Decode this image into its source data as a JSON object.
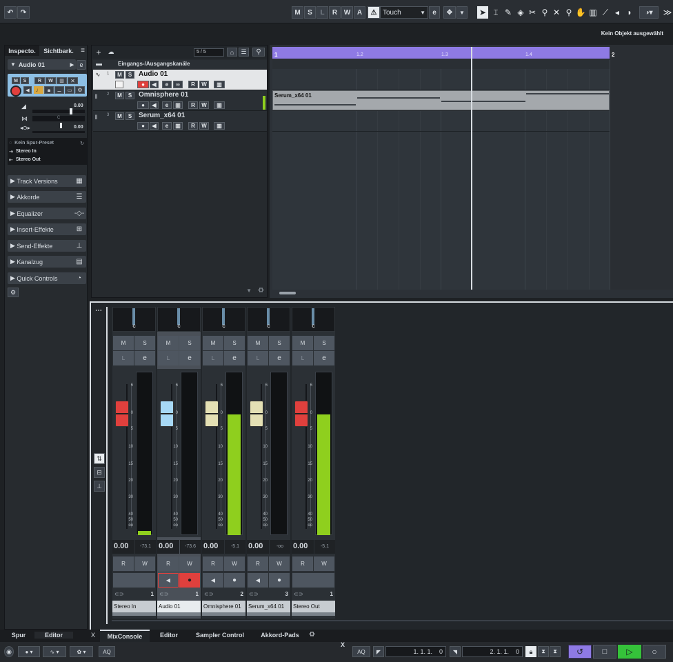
{
  "toolbar": {
    "undo": "↶",
    "redo": "↷",
    "mode_buttons": [
      "M",
      "S",
      "L",
      "R",
      "W",
      "A"
    ],
    "automation_mode": "Touch",
    "tools": [
      "pointer-icon",
      "range-icon",
      "pencil-icon",
      "eraser-icon",
      "scissors-icon",
      "glue-icon",
      "mute-icon",
      "zoom-icon",
      "hand-icon",
      "comp-icon",
      "line-icon",
      "play-icon",
      "color-icon"
    ]
  },
  "status": {
    "selection": "Kein Objekt ausgewählt"
  },
  "inspector": {
    "tabs": [
      "Inspecto.",
      "Sichtbark."
    ],
    "track_name": "Audio 01",
    "vol_value": "0.00",
    "pan_value": "0.00",
    "pan_letter": "C",
    "routing": [
      "Kein Spur-Preset",
      "Stereo In",
      "Stereo Out"
    ],
    "sections": [
      "Track Versions",
      "Akkorde",
      "Equalizer",
      "Insert-Effekte",
      "Send-Effekte",
      "Kanalzug",
      "Quick Controls"
    ]
  },
  "project": {
    "counter": "5 / 5",
    "folder_name": "Eingangs-/Ausgangskanäle",
    "tracks": [
      {
        "num": "1",
        "name": "Audio 01"
      },
      {
        "num": "2",
        "name": "Omnisphere 01"
      },
      {
        "num": "3",
        "name": "Serum_x64 01"
      }
    ],
    "ruler": [
      "1",
      "1.2",
      "1.3",
      "1.4",
      "2"
    ],
    "event_name": "Serum_x64 01"
  },
  "mixer": {
    "channels": [
      {
        "name": "Stereo In",
        "num": "1",
        "vol": "0.00",
        "peak": "-73.1",
        "pan": "C",
        "level": 0.02,
        "fader_color": "#e0403d"
      },
      {
        "name": "Audio 01",
        "num": "1",
        "vol": "0.00",
        "peak": "-73.6",
        "pan": "C",
        "level": 0.0,
        "fader_color": "#a7d8f5"
      },
      {
        "name": "Omnisphere 01",
        "num": "2",
        "vol": "0.00",
        "peak": "-5.1",
        "pan": "C",
        "level": 0.74,
        "fader_color": "#e4e0b4"
      },
      {
        "name": "Serum_x64 01",
        "num": "3",
        "vol": "0.00",
        "peak": "-oo",
        "pan": "C",
        "level": 0.0,
        "fader_color": "#e4e0b4"
      },
      {
        "name": "Stereo Out",
        "num": "1",
        "vol": "0.00",
        "peak": "-5.1",
        "pan": "C",
        "level": 0.74,
        "fader_color": "#e0403d"
      }
    ],
    "scale": [
      "6",
      "0",
      "5",
      "10",
      "15",
      "20",
      "30",
      "40",
      "50",
      "oo"
    ],
    "labels": {
      "m": "M",
      "s": "S",
      "l": "L",
      "e": "e",
      "r": "R",
      "w": "W"
    }
  },
  "bottom_tabs": {
    "left": [
      "Spur",
      "Editor"
    ],
    "close": "X",
    "right": [
      "MixConsole",
      "Editor",
      "Sampler Control",
      "Akkord-Pads"
    ]
  },
  "transport": {
    "aq": "AQ",
    "left_locator": "1. 1. 1.    0",
    "right_locator": "2. 1. 1.    0",
    "close": "X"
  },
  "colors": {
    "accent_purple": "#8e7ae4",
    "record_red": "#e0403d",
    "meter_green": "#8fcf1e",
    "play_green": "#35c23a"
  }
}
